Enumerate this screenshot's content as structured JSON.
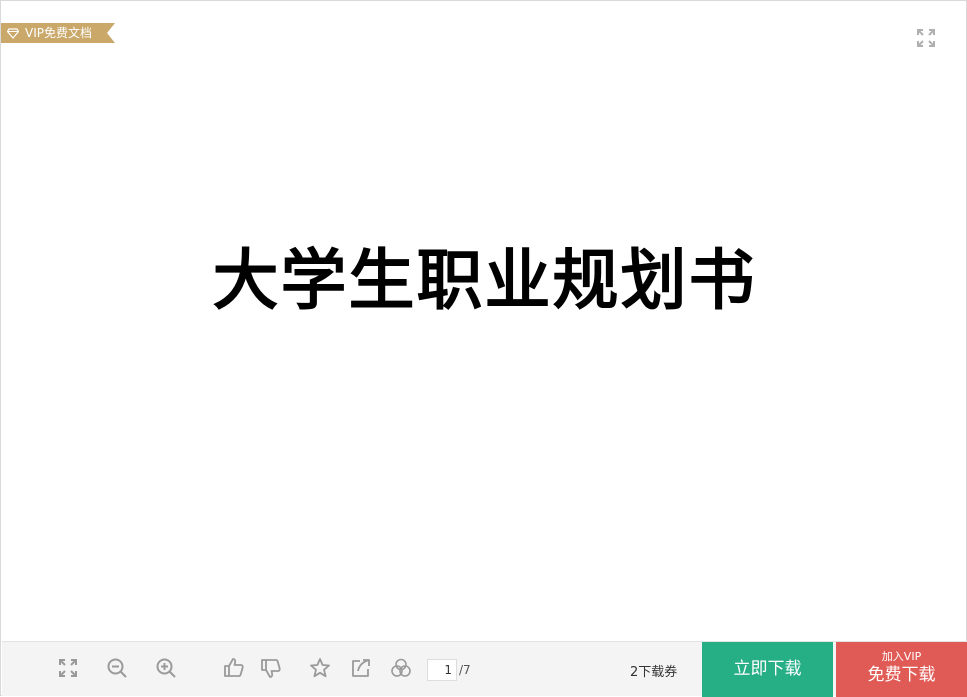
{
  "badge": {
    "label": "VIP免费文档"
  },
  "document": {
    "title": "大学生职业规划书"
  },
  "toolbar": {
    "page_current": "1",
    "page_total": "/7",
    "coupon_text": "2下载券",
    "download_label": "立即下载",
    "vip_small": "加入VIP",
    "vip_big": "免费下载"
  },
  "colors": {
    "ribbon": "#c9a86a",
    "download": "#26ae85",
    "vip": "#e05b55",
    "icon": "#9a9a9a"
  },
  "icons": [
    "gem-icon",
    "fullscreen-icon",
    "zoom-out-icon",
    "zoom-in-icon",
    "thumbs-up-icon",
    "thumbs-down-icon",
    "star-icon",
    "share-icon",
    "circles-icon"
  ]
}
